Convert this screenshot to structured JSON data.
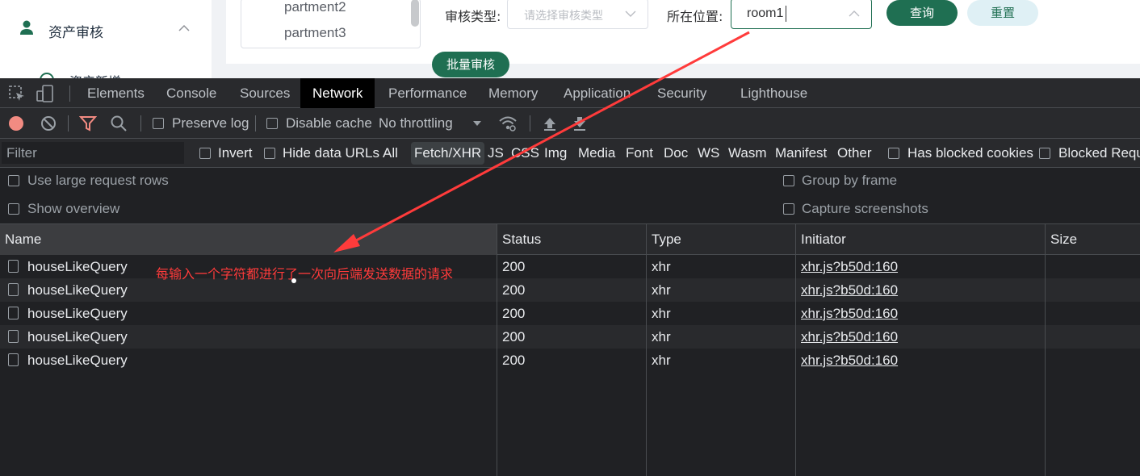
{
  "app": {
    "sidebar": {
      "menu_label": "资产审核",
      "submenu_label": "资产新增"
    },
    "departments": [
      "partment2",
      "partment3"
    ],
    "filters": {
      "type_label": "审核类型:",
      "type_placeholder": "请选择审核类型",
      "location_label": "所在位置:",
      "location_value": "room1"
    },
    "buttons": {
      "query": "查询",
      "reset": "重置",
      "batch": "批量审核"
    },
    "accent_color": "#1f6f52"
  },
  "devtools": {
    "tabs": [
      "Elements",
      "Console",
      "Sources",
      "Network",
      "Performance",
      "Memory",
      "Application",
      "Security",
      "Lighthouse"
    ],
    "active_tab": "Network",
    "toolbar": {
      "preserve_log": "Preserve log",
      "disable_cache": "Disable cache",
      "throttling": "No throttling"
    },
    "filter": {
      "placeholder": "Filter",
      "invert": "Invert",
      "hide_data_urls": "Hide data URLs",
      "types": [
        "All",
        "Fetch/XHR",
        "JS",
        "CSS",
        "Img",
        "Media",
        "Font",
        "Doc",
        "WS",
        "Wasm",
        "Manifest",
        "Other"
      ],
      "active_type": "Fetch/XHR",
      "has_blocked_cookies": "Has blocked cookies",
      "blocked_requests": "Blocked Requests"
    },
    "settings": {
      "large_rows": "Use large request rows",
      "show_overview": "Show overview",
      "group_by_frame": "Group by frame",
      "capture_screenshots": "Capture screenshots"
    },
    "table": {
      "columns": [
        "Name",
        "Status",
        "Type",
        "Initiator",
        "Size"
      ],
      "rows": [
        {
          "name": "houseLikeQuery",
          "status": "200",
          "type": "xhr",
          "initiator": "xhr.js?b50d:160"
        },
        {
          "name": "houseLikeQuery",
          "status": "200",
          "type": "xhr",
          "initiator": "xhr.js?b50d:160"
        },
        {
          "name": "houseLikeQuery",
          "status": "200",
          "type": "xhr",
          "initiator": "xhr.js?b50d:160"
        },
        {
          "name": "houseLikeQuery",
          "status": "200",
          "type": "xhr",
          "initiator": "xhr.js?b50d:160"
        },
        {
          "name": "houseLikeQuery",
          "status": "200",
          "type": "xhr",
          "initiator": "xhr.js?b50d:160"
        }
      ]
    }
  },
  "annotation": {
    "text": "每输入一个字符都进行了一次向后端发送数据的请求",
    "color": "#ff3b3b"
  }
}
